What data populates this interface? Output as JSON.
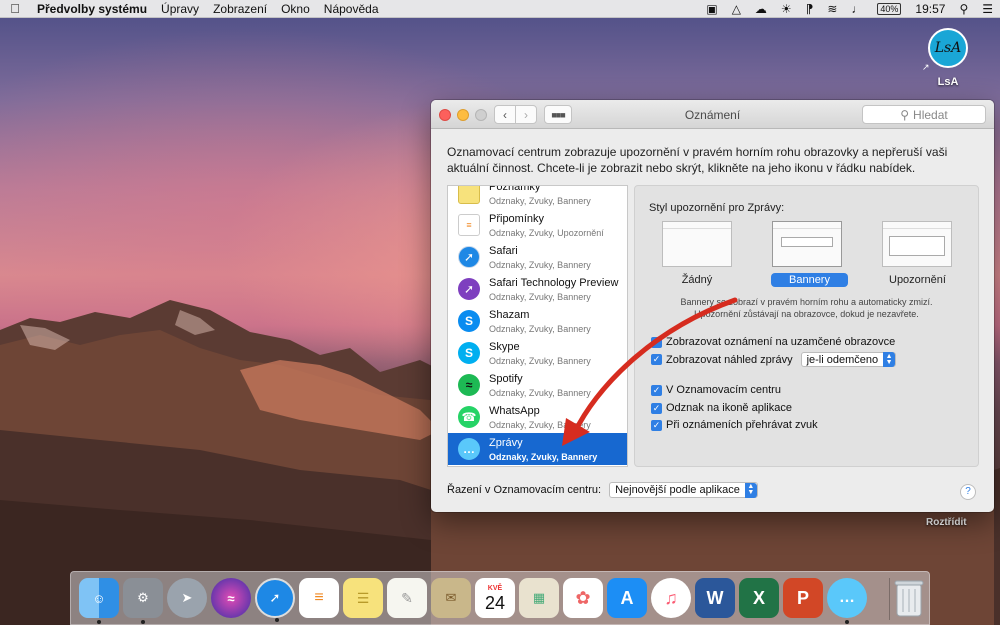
{
  "menubar": {
    "app_name": "Předvolby systému",
    "items": [
      "Úpravy",
      "Zobrazení",
      "Okno",
      "Nápověda"
    ],
    "battery": "40%",
    "time": "19:57"
  },
  "desktop": {
    "icon_initials": "LsA",
    "icon_label": "LsA",
    "stack_label": "Roztřídit"
  },
  "window": {
    "title": "Oznámení",
    "search_placeholder": "Hledat",
    "description": "Oznamovací centrum zobrazuje upozornění v pravém horním rohu obrazovky a nepřeruší vaši aktuální činnost. Chcete-li je zobrazit nebo skrýt, klikněte na jeho ikonu v řádku nabídek.",
    "apps": [
      {
        "name": "Poznámky",
        "sub": "Odznaky, Zvuky, Bannery",
        "icon": "notes-icon",
        "color": "#f4d35e"
      },
      {
        "name": "Připomínky",
        "sub": "Odznaky, Zvuky, Upozornění",
        "icon": "reminders-icon",
        "color": "#ffffff"
      },
      {
        "name": "Safari",
        "sub": "Odznaky, Zvuky, Bannery",
        "icon": "safari-icon",
        "color": "#1e88e5"
      },
      {
        "name": "Safari Technology Preview",
        "sub": "Odznaky, Zvuky, Bannery",
        "icon": "safari-preview-icon",
        "color": "#7e3fbf"
      },
      {
        "name": "Shazam",
        "sub": "Odznaky, Zvuky, Bannery",
        "icon": "shazam-icon",
        "color": "#0a8cf0"
      },
      {
        "name": "Skype",
        "sub": "Odznaky, Zvuky, Bannery",
        "icon": "skype-icon",
        "color": "#00aff0"
      },
      {
        "name": "Spotify",
        "sub": "Odznaky, Zvuky, Bannery",
        "icon": "spotify-icon",
        "color": "#1db954"
      },
      {
        "name": "WhatsApp",
        "sub": "Odznaky, Zvuky, Bannery",
        "icon": "whatsapp-icon",
        "color": "#25d366"
      },
      {
        "name": "Zprávy",
        "sub": "Odznaky, Zvuky, Bannery",
        "icon": "messages-icon",
        "color": "#5ac8fa"
      }
    ],
    "style_heading": "Styl upozornění pro Zprávy:",
    "style_options": [
      "Žádný",
      "Bannery",
      "Upozornění"
    ],
    "selected_style": "Bannery",
    "banner_note_1": "Bannery se zobrazí v pravém horním rohu a automaticky zmizí.",
    "banner_note_2": "Upozornění zůstávají na obrazovce, dokud je nezavřete.",
    "checkboxes": [
      {
        "label": "Zobrazovat oznámení na uzamčené obrazovce",
        "checked": true
      },
      {
        "label": "Zobrazovat náhled zprávy",
        "checked": true
      },
      {
        "label": "V Oznamovacím centru",
        "checked": true
      },
      {
        "label": "Odznak na ikoně aplikace",
        "checked": true
      },
      {
        "label": "Při oznámeních přehrávat zvuk",
        "checked": true
      }
    ],
    "preview_select": "je-li odemčeno",
    "sort_label": "Řazení v Oznamovacím centru:",
    "sort_select": "Nejnovější podle aplikace",
    "help": "?"
  },
  "dock": {
    "calendar_month": "KVĚ",
    "calendar_day": "24",
    "word_letter": "W",
    "excel_letter": "X",
    "powerpoint_letter": "P"
  }
}
